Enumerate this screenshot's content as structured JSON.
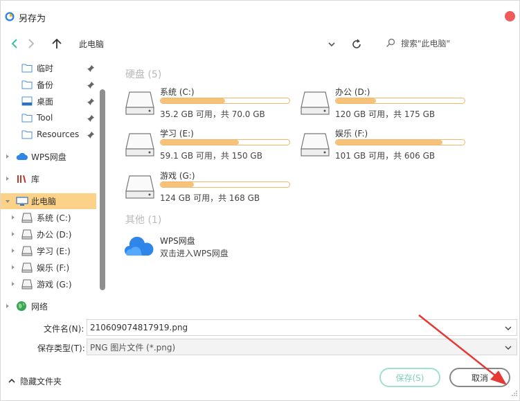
{
  "window": {
    "title": "另存为"
  },
  "nav": {
    "breadcrumb": "此电脑",
    "search_placeholder": "搜索\"此电脑\""
  },
  "sidebar": {
    "quick": [
      {
        "label": "临时",
        "icon": "folder-icon",
        "pinned": true
      },
      {
        "label": "备份",
        "icon": "folder-icon",
        "pinned": true
      },
      {
        "label": "桌面",
        "icon": "desktop-icon",
        "pinned": true
      },
      {
        "label": "Tool",
        "icon": "folder-icon",
        "pinned": true
      },
      {
        "label": "Resources",
        "icon": "folder-icon",
        "pinned": true
      }
    ],
    "wps_cloud": "WPS网盘",
    "library": "库",
    "this_pc": "此电脑",
    "drives": [
      {
        "label": "系统 (C:)"
      },
      {
        "label": "办公 (D:)"
      },
      {
        "label": "学习 (E:)"
      },
      {
        "label": "娱乐 (F:)"
      },
      {
        "label": "游戏 (G:)"
      }
    ],
    "network": "网络"
  },
  "main": {
    "hard_disks_header": "硬盘 (5)",
    "others_header": "其他 (1)",
    "drives": [
      {
        "name": "系统 (C:)",
        "info": "35.2 GB 可用，共 70.0 GB",
        "used_fraction": 0.5
      },
      {
        "name": "办公 (D:)",
        "info": "120 GB 可用，共 175 GB",
        "used_fraction": 0.31
      },
      {
        "name": "学习 (E:)",
        "info": "59.1 GB 可用，共 150 GB",
        "used_fraction": 0.61
      },
      {
        "name": "娱乐 (F:)",
        "info": "101 GB 可用，共 606 GB",
        "used_fraction": 0.83
      },
      {
        "name": "游戏 (G:)",
        "info": "124 GB 可用，共 168 GB",
        "used_fraction": 0.26
      }
    ],
    "cloud": {
      "name": "WPS网盘",
      "desc": "双击进入WPS网盘"
    }
  },
  "form": {
    "filename_label": "文件名(N):",
    "filename_value": "210609074817919.png",
    "filetype_label": "保存类型(T):",
    "filetype_value": "PNG 图片文件 (*.png)"
  },
  "footer": {
    "hide_folders": "隐藏文件夹",
    "save": "保存(S)",
    "cancel": "取消"
  },
  "colors": {
    "selected_bg": "#fbd287",
    "bar_fill": "#f6c27a",
    "bar_border": "#f0b76a",
    "close": "#ef5b5b",
    "save_border": "#9fe0cf",
    "annotation_arrow": "#e53935"
  }
}
